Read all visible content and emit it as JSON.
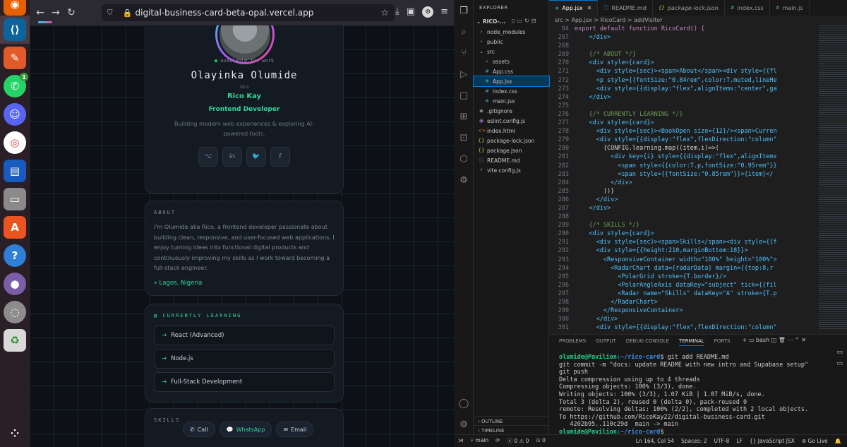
{
  "browser": {
    "url": "digital-business-card-beta-opal.vercel.app",
    "card": {
      "availability": "Available for work",
      "name": "Olayinka Olumide",
      "aka": "aka",
      "nickname": "Rico Kay",
      "role": "Frontend Developer",
      "tagline": "Building modern web experiences & exploring AI-powered tools."
    },
    "about": {
      "title": "ABOUT",
      "text": "I'm Olumide aka Rico, a frontend developer passionate about building clean, responsive, and user-focused web applications. I enjoy turning ideas into functional digital products and continuously improving my skills as I work toward becoming a full-stack engineer.",
      "location": "Lagos, Nigeria"
    },
    "learning": {
      "title": "CURRENTLY LEARNING",
      "items": [
        "React (Advanced)",
        "Node.js",
        "Full-Stack Development"
      ]
    },
    "skills": {
      "title": "SKILLS"
    },
    "contact": {
      "call": "Call",
      "whatsapp": "WhatsApp",
      "email": "Email"
    }
  },
  "vscode": {
    "explorer": {
      "header": "EXPLORER",
      "project": "RICO-...",
      "tree": [
        "node_modules",
        "public",
        "src",
        "assets",
        "App.css",
        "App.jsx",
        "index.css",
        "main.jsx",
        ".gitignore",
        "eslint.config.js",
        "index.html",
        "package-lock.json",
        "package.json",
        "README.md",
        "vite.config.js"
      ],
      "outline": "OUTLINE",
      "timeline": "TIMELINE"
    },
    "tabs": [
      "App.jsx",
      "README.md",
      "package-lock.json",
      "index.css",
      "main.js"
    ],
    "breadcrumbs": "src  >  App.jsx  >  RicoCard  >  addVisitor",
    "code": [
      {
        "n": "84",
        "t": "export default function RicoCard() {"
      },
      {
        "n": "267",
        "t": "    </div>"
      },
      {
        "n": "268",
        "t": ""
      },
      {
        "n": "269",
        "t": "    {/* ABOUT */}"
      },
      {
        "n": "270",
        "t": "    <div style={card}>"
      },
      {
        "n": "271",
        "t": "      <div style={sec}><span>About</span><div style={{fl"
      },
      {
        "n": "272",
        "t": "      <p style={{fontSize:\"0.84rem\",color:T.muted,lineHe"
      },
      {
        "n": "273",
        "t": "      <div style={{display:\"flex\",alignItems:\"center\",ga"
      },
      {
        "n": "274",
        "t": "    </div>"
      },
      {
        "n": "275",
        "t": ""
      },
      {
        "n": "276",
        "t": "    {/* CURRENTLY LEARNING */}"
      },
      {
        "n": "277",
        "t": "    <div style={card}>"
      },
      {
        "n": "278",
        "t": "      <div style={sec}><BookOpen size={12}/><span>Curren"
      },
      {
        "n": "279",
        "t": "      <div style={{display:\"flex\",flexDirection:\"column\""
      },
      {
        "n": "280",
        "t": "        {CONFIG.learning.map((item,i)=>("
      },
      {
        "n": "281",
        "t": "          <div key={i} style={{display:\"flex\",alignItems"
      },
      {
        "n": "282",
        "t": "            <span style={{color:T.p,fontSize:\"0.95rem\"}}"
      },
      {
        "n": "283",
        "t": "            <span style={{fontSize:\"0.85rem\"}}>{item}</"
      },
      {
        "n": "284",
        "t": "          </div>"
      },
      {
        "n": "285",
        "t": "        ))}"
      },
      {
        "n": "286",
        "t": "      </div>"
      },
      {
        "n": "287",
        "t": "    </div>"
      },
      {
        "n": "288",
        "t": ""
      },
      {
        "n": "289",
        "t": "    {/* SKILLS */}"
      },
      {
        "n": "290",
        "t": "    <div style={card}>"
      },
      {
        "n": "291",
        "t": "      <div style={sec}><span>Skills</span><div style={{f"
      },
      {
        "n": "292",
        "t": "      <div style={{height:210,marginBottom:18}}>"
      },
      {
        "n": "293",
        "t": "        <ResponsiveContainer width=\"100%\" height=\"100%\">"
      },
      {
        "n": "294",
        "t": "          <RadarChart data={radarData} margin={{top:8,r"
      },
      {
        "n": "295",
        "t": "            <PolarGrid stroke={T.border}/>"
      },
      {
        "n": "296",
        "t": "            <PolarAngleAxis dataKey=\"subject\" tick={{fil"
      },
      {
        "n": "297",
        "t": "            <Radar name=\"Skills\" dataKey=\"A\" stroke={T.p"
      },
      {
        "n": "298",
        "t": "          </RadarChart>"
      },
      {
        "n": "299",
        "t": "        </ResponsiveContainer>"
      },
      {
        "n": "300",
        "t": "      </div>"
      },
      {
        "n": "301",
        "t": "      <div style={{display:\"flex\",flexDirection:\"column\""
      }
    ],
    "panel_tabs": [
      "PROBLEMS",
      "OUTPUT",
      "DEBUG CONSOLE",
      "TERMINAL",
      "PORTS"
    ],
    "shell": "bash",
    "terminal": [
      {
        "user": "olumide@Pavilion",
        "path": ":~/rico-card",
        "cmd": "$ git add README.md"
      },
      {
        "text": "git commit -m \"docs: update README with new intro and Supabase setup\""
      },
      {
        "text": "git push"
      },
      {
        "text": "Delta compression using up to 4 threads"
      },
      {
        "text": "Compressing objects: 100% (3/3), done."
      },
      {
        "text": "Writing objects: 100% (3/3), 1.07 KiB | 1.07 MiB/s, done."
      },
      {
        "text": "Total 3 (delta 2), reused 0 (delta 0), pack-reused 0"
      },
      {
        "text": "remote: Resolving deltas: 100% (2/2), completed with 2 local objects."
      },
      {
        "text": "To https://github.com/RicoKay22/digital-business-card.git"
      },
      {
        "text": "   4202b95..110c29d  main -> main"
      },
      {
        "user": "olumide@Pavilion",
        "path": ":~/rico-card",
        "cmd": "$ "
      }
    ],
    "status": {
      "branch": "main",
      "errors": "0",
      "warnings": "0",
      "ports": "0",
      "position": "Ln 164, Col 54",
      "spaces": "Spaces: 2",
      "encoding": "UTF-8",
      "eol": "LF",
      "language": "JavaScript JSX",
      "golive": "Go Live"
    }
  },
  "colors": {
    "accent": "#34d399",
    "vscode_blue": "#0078d4"
  }
}
